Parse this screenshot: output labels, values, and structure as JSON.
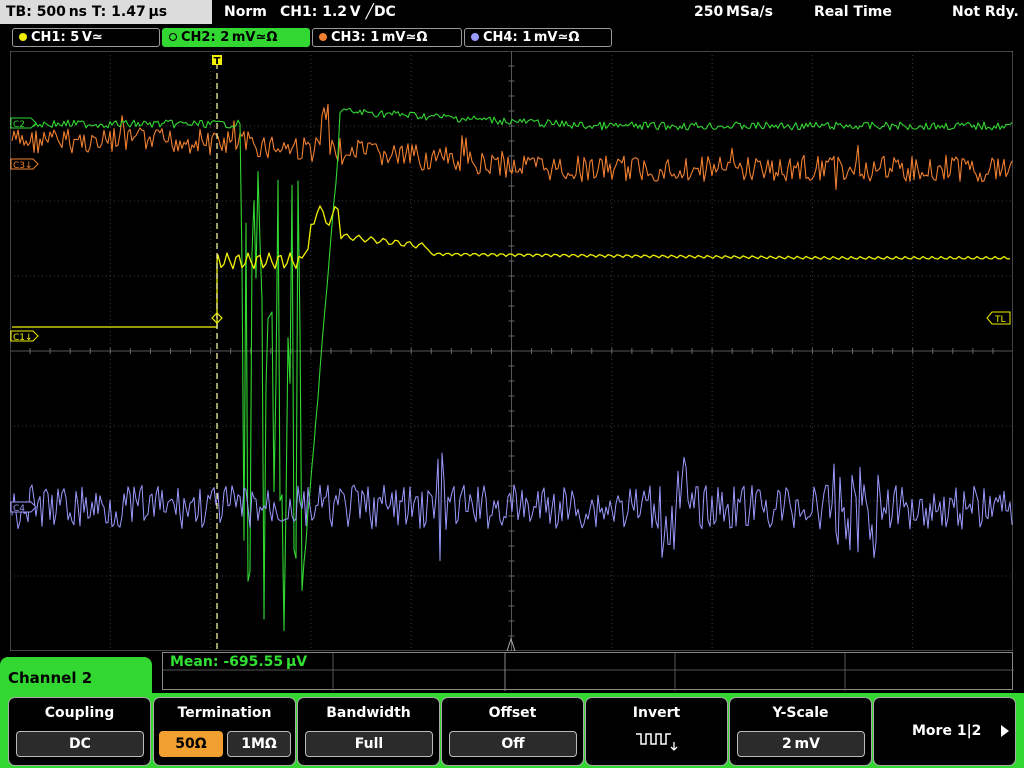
{
  "status_bar": {
    "timebase": "TB: 500 ns   T: 1.47 µs",
    "mode": "Norm",
    "trigger": "CH1: 1.2 V ╱DC",
    "sample_rate": "250 MSa/s",
    "acq_mode": "Real Time",
    "status": "Not Rdy."
  },
  "channels": [
    {
      "label": "CH1: 5 V≃",
      "color": "#f0f000"
    },
    {
      "label": "CH2: 2 mV≃Ω",
      "color": "#32d732"
    },
    {
      "label": "CH3: 1 mV≃Ω",
      "color": "#f08030"
    },
    {
      "label": "CH4: 1 mV≃Ω",
      "color": "#9a9aff"
    }
  ],
  "markers": {
    "c2": "C2",
    "c3": "C3↓",
    "c1": "C1↓",
    "c4": "C4",
    "trigger_level": "TL",
    "trigger_pos": "T"
  },
  "measurement": {
    "mean": "Mean: -695.55 µV"
  },
  "menu": {
    "channel_tab": "Channel 2",
    "coupling": {
      "title": "Coupling",
      "value": "DC"
    },
    "termination": {
      "title": "Termination",
      "opt1": "50Ω",
      "opt2": "1MΩ"
    },
    "bandwidth": {
      "title": "Bandwidth",
      "value": "Full"
    },
    "offset": {
      "title": "Offset",
      "value": "Off"
    },
    "invert": {
      "title": "Invert"
    },
    "yscale": {
      "title": "Y-Scale",
      "value": "2 mV"
    },
    "more": {
      "label": "More 1|2"
    }
  },
  "colors": {
    "ch1": "#f0f000",
    "ch2": "#32d732",
    "ch3": "#f08030",
    "ch4": "#9a9aff",
    "grid": "#3c3c3c"
  }
}
